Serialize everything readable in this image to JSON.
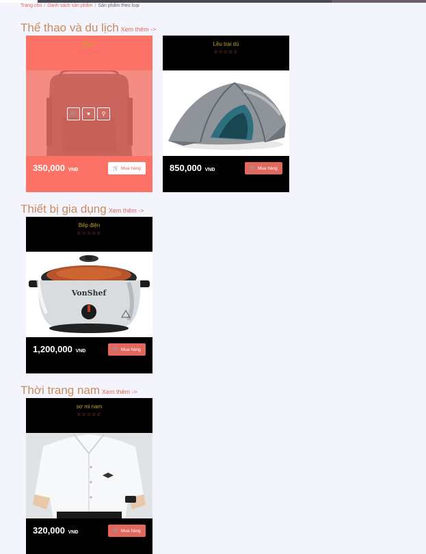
{
  "breadcrumb": {
    "home": "Trang chủ",
    "list": "Danh sách sản phẩm",
    "current": "Sản phẩm theo loại"
  },
  "sections": [
    {
      "title": "Thể thao và du lịch",
      "more": "Xem thêm ->"
    },
    {
      "title": "Thiết bị gia dụng",
      "more": "Xem thêm ->"
    },
    {
      "title": "Thời trang nam",
      "more": "Xem thêm ->"
    }
  ],
  "products": [
    {
      "name": "Balo",
      "rating": "☆☆☆☆☆",
      "price": "350,000",
      "currency": "VNĐ",
      "buy": "Mua hàng",
      "image": "backpack"
    },
    {
      "name": "Lều trại dù",
      "rating": "☆☆☆☆☆",
      "price": "850,000",
      "currency": "VNĐ",
      "buy": "Mua hàng",
      "image": "tent"
    },
    {
      "name": "Bếp điện",
      "rating": "☆☆☆☆☆",
      "price": "1,200,000",
      "currency": "VNĐ",
      "buy": "Mua hàng",
      "image": "slow-cooker",
      "brand": "VonShef"
    },
    {
      "name": "sơ mi nam",
      "rating": "☆☆☆☆☆",
      "price": "320,000",
      "currency": "VNĐ",
      "buy": "Mua hàng",
      "image": "white-shirt"
    }
  ],
  "card_actions": [
    "cart-icon",
    "heart-icon",
    "search-icon"
  ],
  "colors": {
    "accent": "#e2675d",
    "hover_bg": "#fd7267",
    "title": "#c98a5e",
    "product_name": "#c7a32a",
    "page_bg": "#f4f5fc"
  }
}
